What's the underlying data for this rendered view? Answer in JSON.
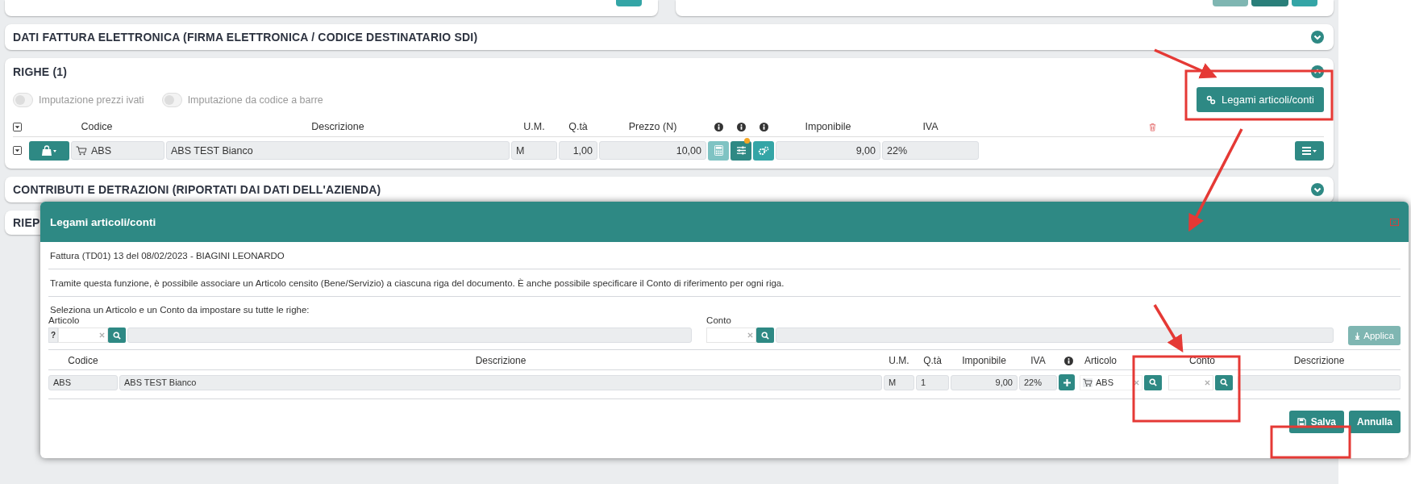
{
  "sections": [
    {
      "title": "DATI FATTURA ELETTRONICA (FIRMA ELETTRONICA / CODICE DESTINATARIO SDI)",
      "expanded": false
    }
  ],
  "righe": {
    "title": "RIGHE (1)",
    "expanded": true,
    "toggles": [
      {
        "label": "Imputazione prezzi ivati",
        "on": false
      },
      {
        "label": "Imputazione da codice a barre",
        "on": false
      }
    ],
    "link_button": "Legami articoli/conti",
    "columns": [
      "Codice",
      "Descrizione",
      "U.M.",
      "Q.tà",
      "Prezzo (N)",
      "Imponibile",
      "IVA"
    ],
    "row": {
      "codice": "ABS",
      "descrizione": "ABS TEST Bianco",
      "um": "M",
      "qta": "1,00",
      "prezzo": "10,00",
      "imponibile": "9,00",
      "iva": "22%"
    }
  },
  "contributi": {
    "title": "CONTRIBUTI E DETRAZIONI (RIPORTATI DAI DATI DELL'AZIENDA)",
    "expanded": false
  },
  "riepilogo": {
    "title": "RIEP"
  },
  "dialog": {
    "title": "Legami articoli/conti",
    "document": "Fattura (TD01) 13 del 08/02/2023 - BIAGINI LEONARDO",
    "info": "Tramite questa funzione, è possibile associare un Articolo censito (Bene/Servizio) a ciascuna riga del documento. È anche possibile specificare il Conto di riferimento per ogni riga.",
    "prompt": "Seleziona un Articolo e un Conto da impostare su tutte le righe:",
    "articolo_label": "Articolo",
    "articolo_prefix": "?",
    "conto_label": "Conto",
    "apply_button": {
      "label": "Applica",
      "disabled": true
    },
    "columns": [
      "Codice",
      "Descrizione",
      "U.M.",
      "Q.tà",
      "Imponibile",
      "IVA",
      "Articolo",
      "Conto",
      "Descrizione"
    ],
    "row": {
      "codice": "ABS",
      "descrizione": "ABS TEST Bianco",
      "um": "M",
      "qta": "1",
      "imponibile": "9,00",
      "iva": "22%",
      "articolo": "ABS"
    },
    "buttons": [
      "Salva",
      "Annulla"
    ]
  }
}
